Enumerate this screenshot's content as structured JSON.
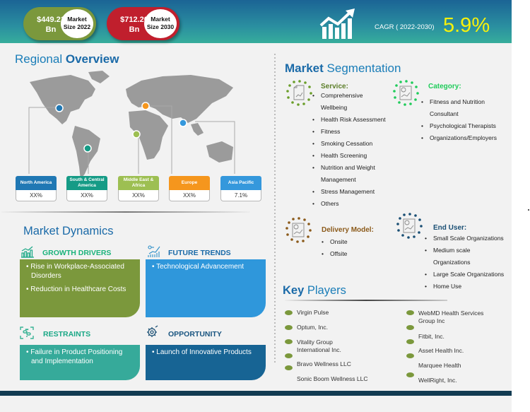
{
  "header": {
    "market_2022": {
      "value": "$449.21\nBn",
      "value_line1": "$449.21",
      "value_line2": "Bn",
      "label_line1": "Market",
      "label_line2": "Size 2022"
    },
    "market_2030": {
      "value_line1": "$712.20",
      "value_line2": "Bn",
      "label_line1": "Market",
      "label_line2": "Size 2030"
    },
    "cagr_label": "CAGR ( 2022-2030)",
    "cagr_value": "5.9%",
    "icon": "growth-chart-icon"
  },
  "regional_overview": {
    "title_part1": "Regional",
    "title_part2": "Overview",
    "regions": [
      {
        "name": "North America",
        "value": "XX%",
        "color": "#2078b4"
      },
      {
        "name": "South & Central America",
        "value": "XX%",
        "color": "#159b86"
      },
      {
        "name": "Middle East & Africa",
        "value": "XX%",
        "color": "#9dbf52"
      },
      {
        "name": "Europe",
        "value": "XX%",
        "color": "#f5961d"
      },
      {
        "name": "Asia Pacific",
        "value": "7.1%",
        "color": "#3598dc"
      }
    ]
  },
  "market_dynamics": {
    "title": "Market Dynamics",
    "growth_drivers": {
      "label": "GROWTH DRIVERS",
      "items": [
        "Rise in Workplace-Associated Disorders",
        "Reduction in Healthcare Costs"
      ]
    },
    "future_trends": {
      "label": "FUTURE TRENDS",
      "items": [
        "Technological Advancement"
      ]
    },
    "restraints": {
      "label": "RESTRAINTS",
      "items": [
        "Failure in Product Positioning and Implementation"
      ]
    },
    "opportunity": {
      "label": "OPPORTUNITY",
      "items": [
        "Launch of Innovative Products"
      ]
    }
  },
  "market_segmentation": {
    "title_part1": "Market",
    "title_part2": "Segmentation",
    "service": {
      "label": "Service:",
      "items": [
        "Comprehensive",
        "Wellbeing",
        "Health Risk Assessment",
        "Fitness",
        "Smoking Cessation",
        "Health Screening",
        "Nutrition and Weight",
        "Management",
        "Stress Management",
        "Others"
      ]
    },
    "category": {
      "label": "Category:",
      "items": [
        "Fitness and Nutrition",
        "Consultant",
        "Psychological Therapists",
        "Organizations/Employers"
      ]
    },
    "delivery_model": {
      "label": "Delivery Model:",
      "items": [
        "Onsite",
        "Offsite"
      ]
    },
    "end_user": {
      "label": "End User:",
      "items": [
        "Small Scale Organizations",
        "Medium scale",
        "Organizations",
        "Large Scale Organizations",
        "Home Use"
      ]
    }
  },
  "key_players": {
    "title_part1": "Key",
    "title_part2": "Players",
    "left": [
      "Virgin Pulse",
      "Optum, Inc.",
      "Vitality Group\nInternational Inc.",
      "Bravo Wellness LLC",
      "Sonic Boom Wellness LLC"
    ],
    "right": [
      "WebMD Health Services\nGroup Inc",
      "Fitbit, Inc.",
      "Asset Health Inc.",
      "Marquee Health",
      "WellRight, Inc."
    ]
  },
  "colors": {
    "green": "#7b983c",
    "red": "#c01f2d",
    "blue_title": "#1a6aa8",
    "cagr_yellow": "#f6f10c",
    "footer": "#123b52"
  }
}
